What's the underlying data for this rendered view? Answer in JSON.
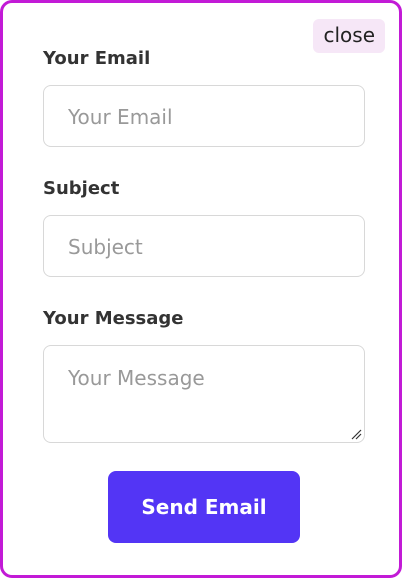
{
  "modal": {
    "close_label": "close",
    "email": {
      "label": "Your Email",
      "placeholder": "Your Email"
    },
    "subject": {
      "label": "Subject",
      "placeholder": "Subject"
    },
    "message": {
      "label": "Your Message",
      "placeholder": "Your Message"
    },
    "submit_label": "Send Email"
  },
  "colors": {
    "border": "#c21ad6",
    "close_bg": "#f6e7f7",
    "submit_bg": "#5335f5"
  },
  "icons": {
    "resize": "resize-handle-icon"
  }
}
